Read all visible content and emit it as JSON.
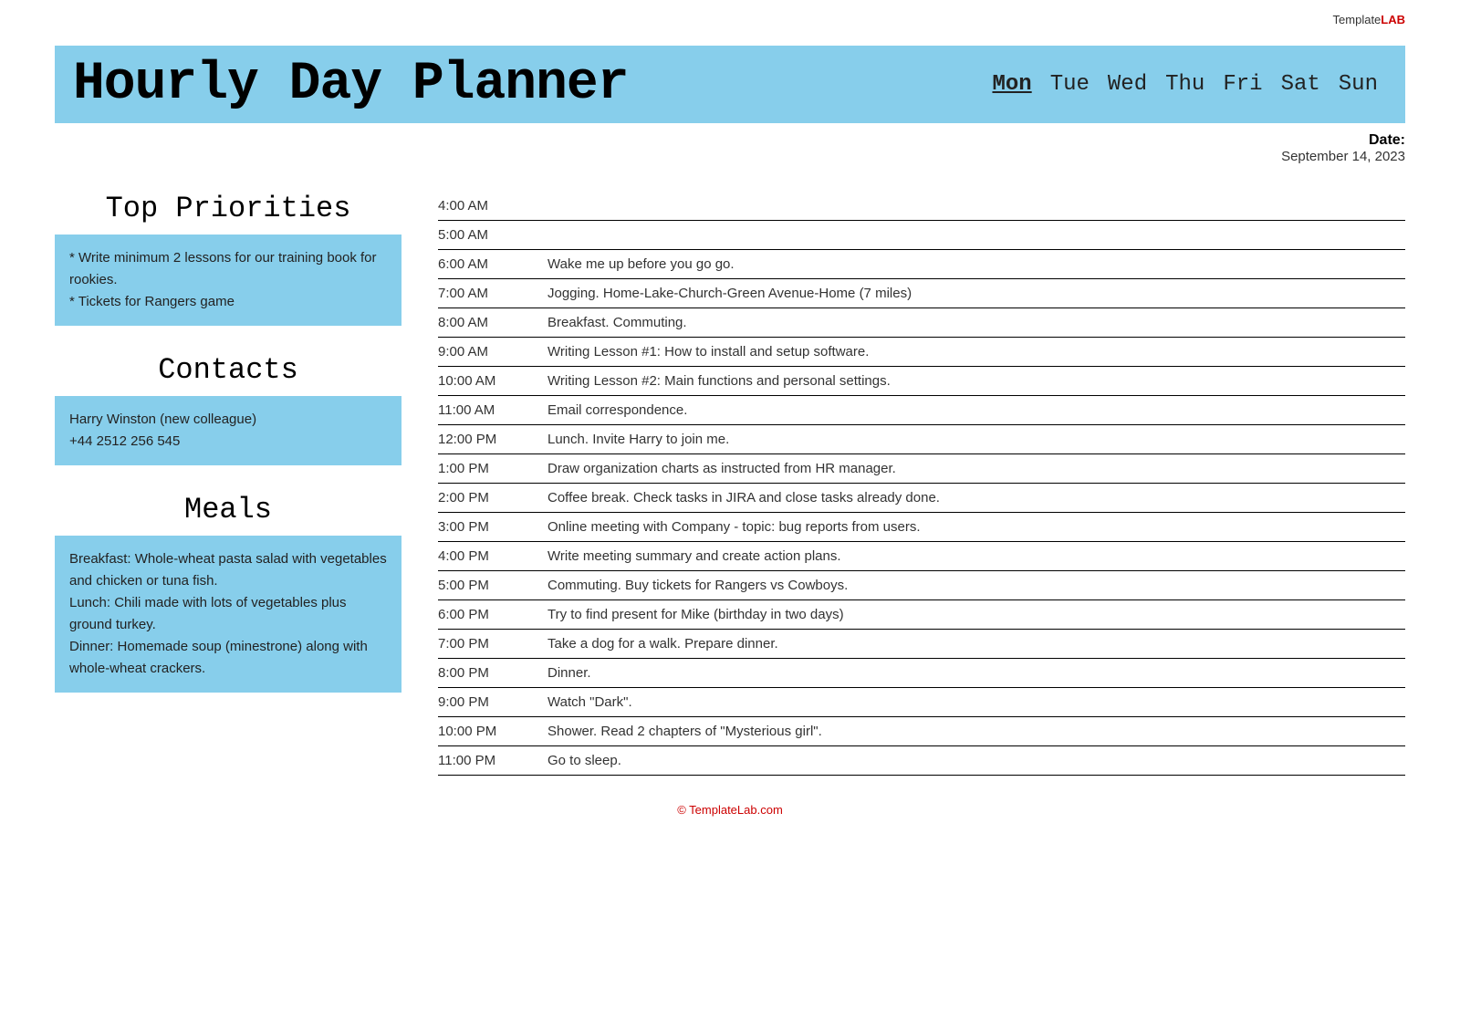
{
  "logo": {
    "template": "Template",
    "lab": "LAB"
  },
  "header": {
    "title": "Hourly Day Planner",
    "days": [
      {
        "id": "mon",
        "label": "Mon",
        "active": true
      },
      {
        "id": "tue",
        "label": "Tue",
        "active": false
      },
      {
        "id": "wed",
        "label": "Wed",
        "active": false
      },
      {
        "id": "thu",
        "label": "Thu",
        "active": false
      },
      {
        "id": "fri",
        "label": "Fri",
        "active": false
      },
      {
        "id": "sat",
        "label": "Sat",
        "active": false
      },
      {
        "id": "sun",
        "label": "Sun",
        "active": false
      }
    ]
  },
  "date": {
    "label": "Date:",
    "value": "September 14, 2023"
  },
  "priorities": {
    "title": "Top Priorities",
    "items": [
      "* Write minimum 2 lessons for our training book for rookies.",
      "* Tickets for Rangers game"
    ]
  },
  "contacts": {
    "title": "Contacts",
    "content": "Harry Winston (new colleague)\n+44 2512 256 545"
  },
  "meals": {
    "title": "Meals",
    "content": "Breakfast: Whole-wheat pasta salad with vegetables and chicken or tuna fish.\nLunch: Chili made with lots of vegetables plus ground turkey.\nDinner: Homemade soup (minestrone) along with whole-wheat crackers."
  },
  "schedule": [
    {
      "time": "4:00 AM",
      "event": ""
    },
    {
      "time": "5:00 AM",
      "event": ""
    },
    {
      "time": "6:00 AM",
      "event": "Wake me up before you go go."
    },
    {
      "time": "7:00 AM",
      "event": "Jogging. Home-Lake-Church-Green Avenue-Home (7 miles)"
    },
    {
      "time": "8:00 AM",
      "event": "Breakfast. Commuting."
    },
    {
      "time": "9:00 AM",
      "event": "Writing Lesson #1: How to install and setup software."
    },
    {
      "time": "10:00 AM",
      "event": "Writing Lesson #2: Main functions and personal settings."
    },
    {
      "time": "11:00 AM",
      "event": "Email correspondence."
    },
    {
      "time": "12:00 PM",
      "event": "Lunch. Invite Harry to join me."
    },
    {
      "time": "1:00 PM",
      "event": "Draw organization charts as instructed from HR manager."
    },
    {
      "time": "2:00 PM",
      "event": "Coffee break. Check tasks in JIRA and close tasks already done."
    },
    {
      "time": "3:00 PM",
      "event": "Online meeting with Company - topic: bug reports from users."
    },
    {
      "time": "4:00 PM",
      "event": "Write meeting summary and create action plans."
    },
    {
      "time": "5:00 PM",
      "event": "Commuting. Buy tickets for Rangers vs Cowboys."
    },
    {
      "time": "6:00 PM",
      "event": "Try to find present for Mike (birthday in two days)"
    },
    {
      "time": "7:00 PM",
      "event": "Take a dog for a walk. Prepare dinner."
    },
    {
      "time": "8:00 PM",
      "event": "Dinner."
    },
    {
      "time": "9:00 PM",
      "event": "Watch \"Dark\"."
    },
    {
      "time": "10:00 PM",
      "event": "Shower. Read 2 chapters of \"Mysterious girl\"."
    },
    {
      "time": "11:00 PM",
      "event": "Go to sleep."
    }
  ],
  "footer": {
    "link_text": "© TemplateLab.com"
  }
}
